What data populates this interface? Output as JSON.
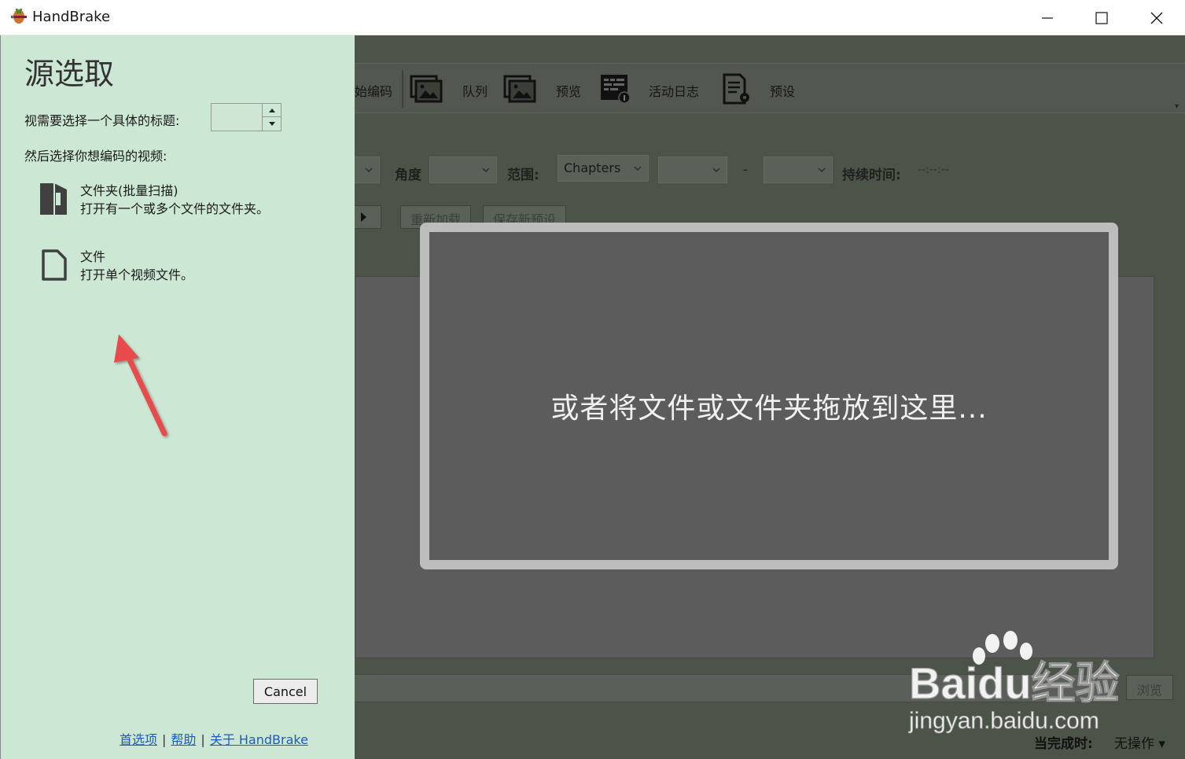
{
  "window": {
    "title": "HandBrake"
  },
  "toolbar": {
    "items": [
      {
        "label": "始编码"
      },
      {
        "label": "队列"
      },
      {
        "label": "预览"
      },
      {
        "label": "活动日志"
      },
      {
        "label": "预设"
      }
    ]
  },
  "source_settings": {
    "angle_label": "角度",
    "range_label": "范围:",
    "range_value": "Chapters",
    "dash": "-",
    "duration_label": "持续时间:",
    "duration_value": "--:--:--"
  },
  "preset_buttons": {
    "reload": "重新加载",
    "save_new": "保存新预设"
  },
  "drop_zone": {
    "text": "或者将文件或文件夹拖放到这里..."
  },
  "destination": {
    "browse": "浏览"
  },
  "status": {
    "label": "当完成时:",
    "value": "无操作"
  },
  "source_panel": {
    "title": "源选取",
    "title_prompt": "视需要选择一个具体的标题:",
    "title_value": "",
    "video_prompt": "然后选择你想编码的视频:",
    "folder_option": {
      "title": "文件夹(批量扫描)",
      "description": "打开有一个或多个文件的文件夹。"
    },
    "file_option": {
      "title": "文件",
      "description": "打开单个视频文件。"
    },
    "cancel": "Cancel",
    "links": {
      "preferences": "首选项",
      "help": "帮助",
      "about": "关于 HandBrake",
      "separator": "|"
    }
  },
  "watermark": {
    "brand": "Baidu经验",
    "url": "jingyan.baidu.com"
  },
  "colors": {
    "panel_bg": "#cce8d4",
    "overlay_bg": "#4c5449",
    "link": "#1e5bbf",
    "arrow": "#e84b4b"
  }
}
